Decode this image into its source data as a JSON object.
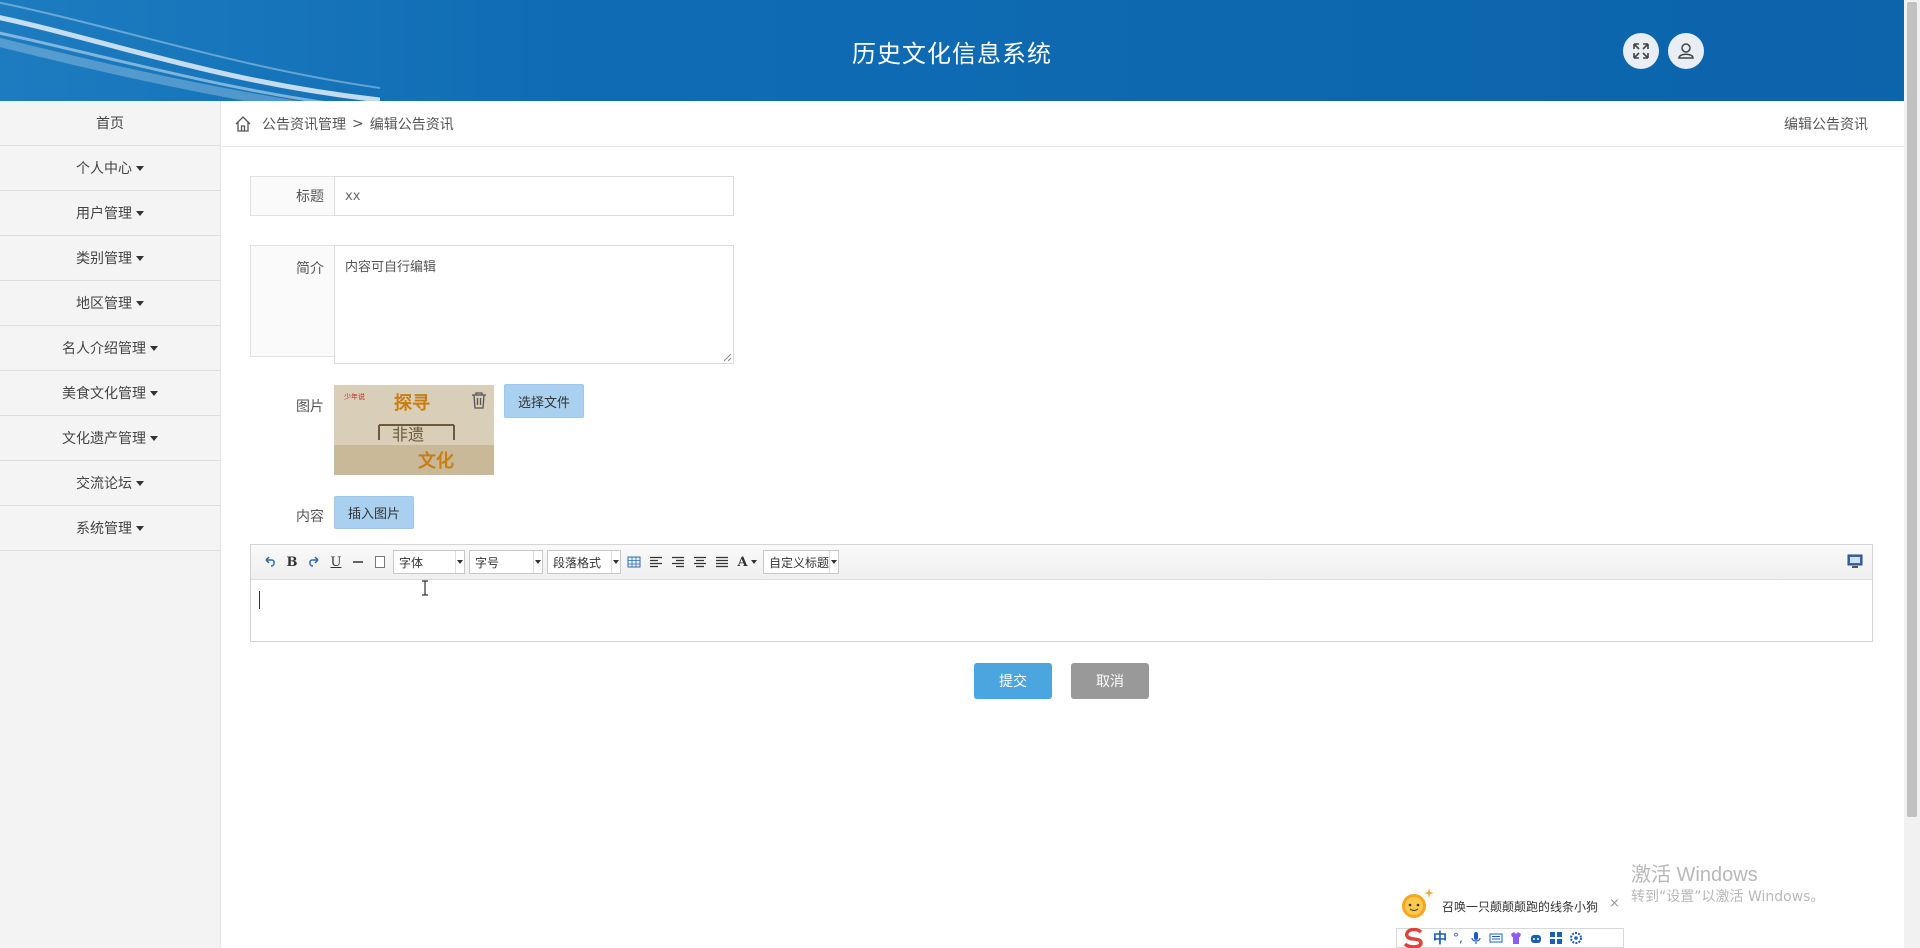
{
  "app": {
    "title": "历史文化信息系统"
  },
  "header": {
    "fullscreen_icon": "expand-icon",
    "user_icon": "user-icon"
  },
  "sidebar": {
    "items": [
      {
        "label": "首页",
        "has_dropdown": false
      },
      {
        "label": "个人中心",
        "has_dropdown": true
      },
      {
        "label": "用户管理",
        "has_dropdown": true
      },
      {
        "label": "类别管理",
        "has_dropdown": true
      },
      {
        "label": "地区管理",
        "has_dropdown": true
      },
      {
        "label": "名人介绍管理",
        "has_dropdown": true
      },
      {
        "label": "美食文化管理",
        "has_dropdown": true
      },
      {
        "label": "文化遗产管理",
        "has_dropdown": true
      },
      {
        "label": "交流论坛",
        "has_dropdown": true
      },
      {
        "label": "系统管理",
        "has_dropdown": true
      }
    ]
  },
  "breadcrumb": {
    "parent": "公告资讯管理",
    "separator": ">",
    "current": "编辑公告资讯",
    "right_title": "编辑公告资讯"
  },
  "form": {
    "title_label": "标题",
    "title_value": "xx",
    "intro_label": "简介",
    "intro_value": "内容可自行编辑",
    "image_label": "图片",
    "choose_file_label": "选择文件",
    "content_label": "内容",
    "insert_image_label": "插入图片",
    "image_text": {
      "stamp": "少年说",
      "top": "探寻",
      "middle": "非遗",
      "bottom": "文化"
    }
  },
  "editor": {
    "font_select": "字体",
    "size_select": "字号",
    "format_select": "段落格式",
    "custom_title_select": "自定义标题",
    "content": ""
  },
  "actions": {
    "submit_label": "提交",
    "cancel_label": "取消"
  },
  "watermark": {
    "line1": "激活 Windows",
    "line2": "转到“设置”以激活 Windows。"
  },
  "ime": {
    "popup_text": "召唤一只颠颠颠跑的线条小狗",
    "close": "×",
    "mode": "中",
    "punct": "°,"
  },
  "colors": {
    "header_bg": "#0c64ab",
    "primary_button": "#4ba6df",
    "cancel_button": "#999999",
    "light_button": "#a9d0ef"
  }
}
